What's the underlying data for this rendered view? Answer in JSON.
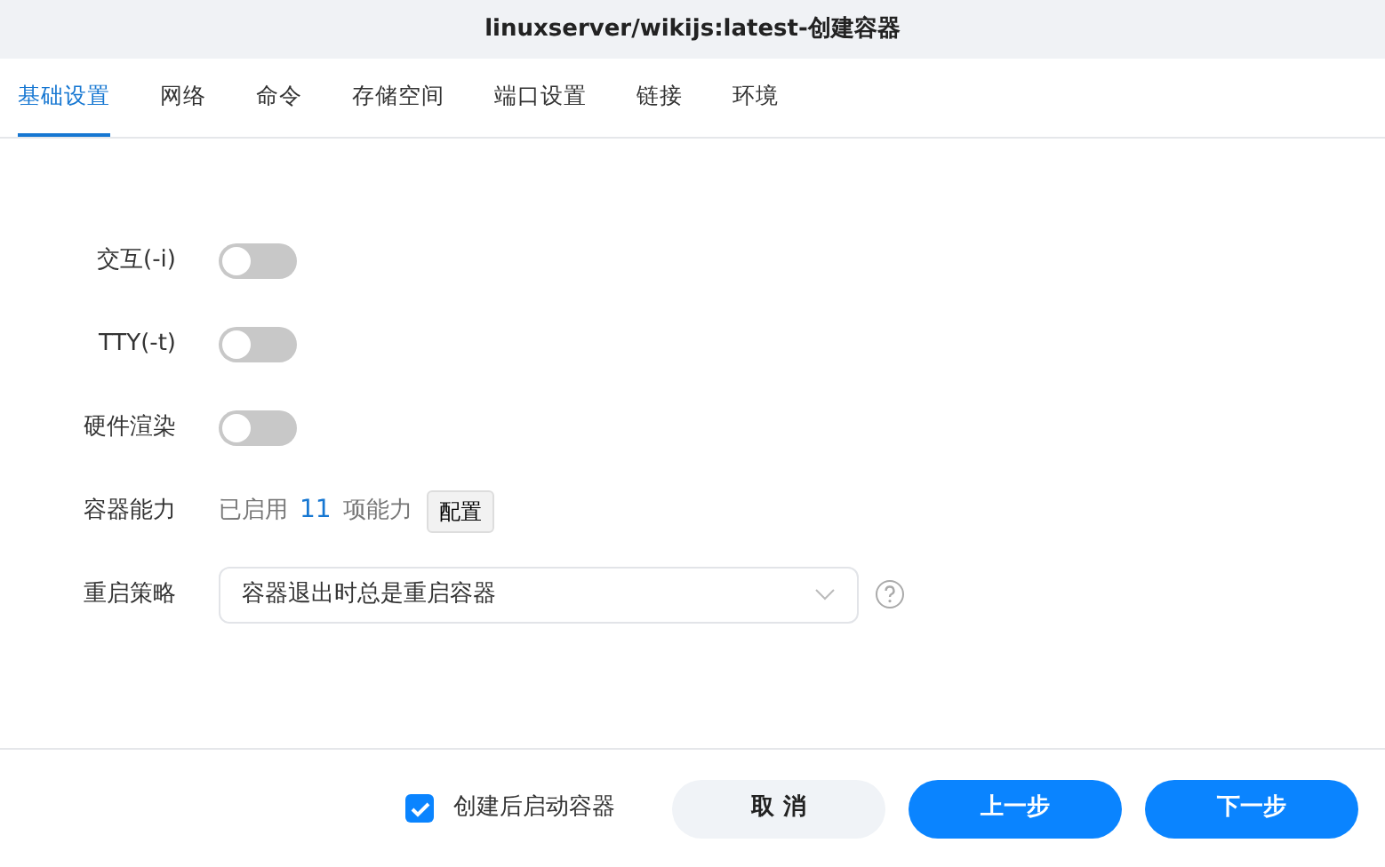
{
  "window": {
    "title": "linuxserver/wikijs:latest-创建容器"
  },
  "tabs": [
    {
      "label": "基础设置",
      "selected": true
    },
    {
      "label": "网络",
      "selected": false
    },
    {
      "label": "命令",
      "selected": false
    },
    {
      "label": "存储空间",
      "selected": false
    },
    {
      "label": "端口设置",
      "selected": false
    },
    {
      "label": "链接",
      "selected": false
    },
    {
      "label": "环境",
      "selected": false
    }
  ],
  "form": [
    {
      "kind": "switch",
      "label": "交互(-i)",
      "on": false
    },
    {
      "kind": "switch",
      "label": "TTY(-t)",
      "on": false
    },
    {
      "kind": "switch",
      "label": "硬件渲染",
      "on": false
    },
    {
      "kind": "capability",
      "label": "容器能力",
      "prefix": "已启用",
      "count": "11",
      "suffix": "项能力",
      "button": "配置"
    },
    {
      "kind": "select",
      "label": "重启策略",
      "value": "容器退出时总是重启容器"
    }
  ],
  "footer": {
    "checkbox": {
      "label": "创建后启动容器",
      "checked": true
    },
    "buttons": [
      {
        "label": "取 消",
        "kind": "secondary"
      },
      {
        "label": "上一步",
        "kind": "primary"
      },
      {
        "label": "下一步",
        "kind": "primary"
      }
    ]
  }
}
